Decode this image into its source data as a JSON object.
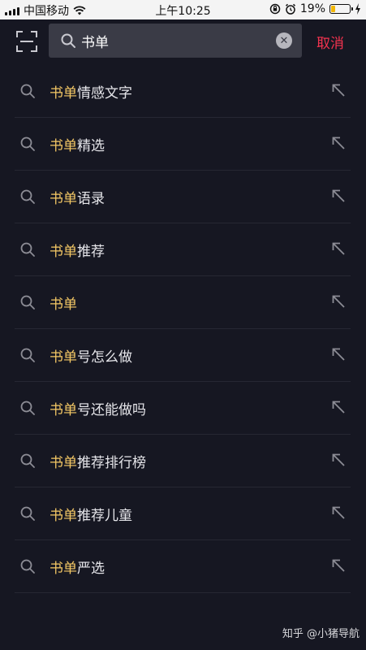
{
  "status_bar": {
    "carrier": "中国移动",
    "time": "上午10:25",
    "battery": "19%",
    "battery_level": 0.19,
    "icons": [
      "signal-icon",
      "wifi-icon",
      "orientation-lock-icon",
      "alarm-icon",
      "battery-icon",
      "charging-icon"
    ]
  },
  "search": {
    "value": "书单",
    "cancel_label": "取消",
    "icons": [
      "scan-icon",
      "search-icon",
      "clear-icon"
    ]
  },
  "results": [
    {
      "prefix": "书单",
      "suffix": "情感文字"
    },
    {
      "prefix": "书单",
      "suffix": "精选"
    },
    {
      "prefix": "书单",
      "suffix": "语录"
    },
    {
      "prefix": "书单",
      "suffix": "推荐"
    },
    {
      "prefix": "书单",
      "suffix": ""
    },
    {
      "prefix": "书单",
      "suffix": "号怎么做"
    },
    {
      "prefix": "书单",
      "suffix": "号还能做吗"
    },
    {
      "prefix": "书单",
      "suffix": "推荐排行榜"
    },
    {
      "prefix": "书单",
      "suffix": "推荐儿童"
    },
    {
      "prefix": "书单",
      "suffix": "严选"
    }
  ],
  "watermark": "知乎 @小猪导航",
  "colors": {
    "background": "#161722",
    "search_box": "#3a3b46",
    "highlight": "#f4c865",
    "cancel": "#f5334f",
    "divider": "#262733"
  }
}
